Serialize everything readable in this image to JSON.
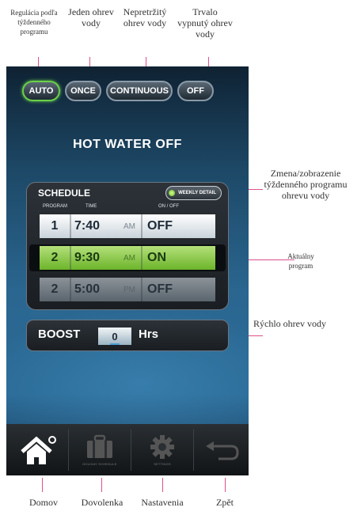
{
  "annotations": {
    "auto": "Regulácia podľa týždenného programu",
    "once": "Jeden ohrev vody",
    "continuous": "Nepretržitý ohrev vody",
    "off": "Trvalo vypnutý ohrev vody",
    "weekly": "Zmena/zobrazenie týždenného programu ohrevu vody",
    "current": "Aktuálny program",
    "boost": "Rýchlo ohrev vody",
    "home": "Domov",
    "holiday": "Dovolenka",
    "settings": "Nastavenia",
    "back": "Zpět"
  },
  "modes": {
    "auto": "AUTO",
    "once": "ONCE",
    "continuous": "CONTINUOUS",
    "off": "OFF",
    "active": "AUTO"
  },
  "status": "HOT WATER OFF",
  "schedule": {
    "title": "SCHEDULE",
    "weekly_button": "WEEKLY DETAIL",
    "columns": {
      "program": "PROGRAM",
      "time": "TIME",
      "onoff": "ON / OFF"
    },
    "rows": [
      {
        "program": "1",
        "time": "7:40",
        "ampm": "AM",
        "state": "OFF"
      },
      {
        "program": "2",
        "time": "9:30",
        "ampm": "AM",
        "state": "ON"
      },
      {
        "program": "2",
        "time": "5:00",
        "ampm": "PM",
        "state": "OFF"
      }
    ]
  },
  "boost": {
    "label": "BOOST",
    "value": "0",
    "unit": "Hrs"
  },
  "nav": {
    "holiday_label": "HOLIDAY SCHEDULE",
    "settings_label": "SETTINGS"
  },
  "colors": {
    "active_green": "#6ad04a",
    "annotation_line": "#e0508c",
    "current_row": "#8ccc4a"
  },
  "icons": [
    "home-icon",
    "suitcase-icon",
    "gear-icon",
    "back-arrow-icon"
  ]
}
